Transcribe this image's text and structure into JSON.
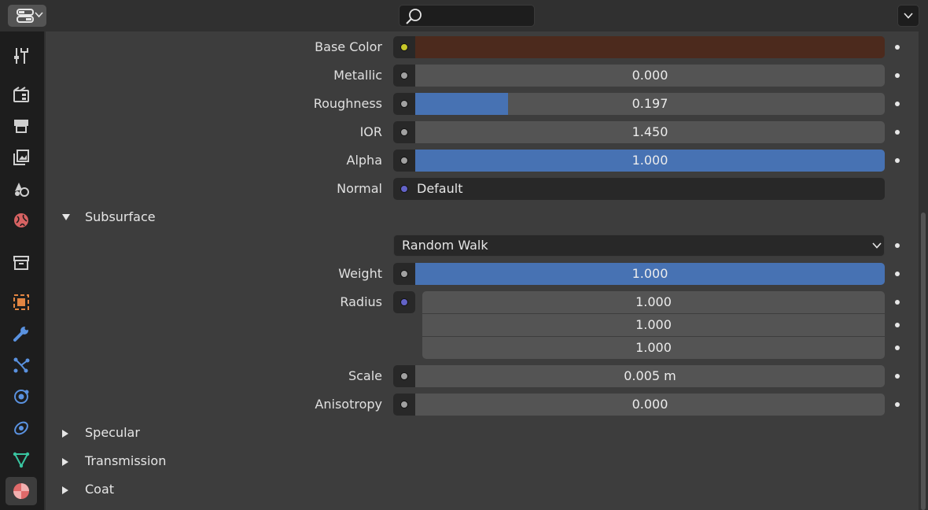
{
  "header": {
    "editor_icon": "editor-type-icon",
    "search_placeholder": "",
    "options_icon": "chevron-down-icon"
  },
  "tabs": [
    {
      "name": "tool-icon",
      "color": "#cfcfcf"
    },
    {
      "name": "render-icon",
      "color": "#cfcfcf"
    },
    {
      "name": "output-icon",
      "color": "#cfcfcf"
    },
    {
      "name": "view-layer-icon",
      "color": "#cfcfcf"
    },
    {
      "name": "scene-icon",
      "color": "#cfcfcf"
    },
    {
      "name": "world-icon",
      "color": "#d76262"
    },
    {
      "name": "collection-icon",
      "color": "#cfcfcf"
    },
    {
      "name": "object-icon",
      "color": "#e28542"
    },
    {
      "name": "modifier-icon",
      "color": "#5a92e0"
    },
    {
      "name": "particles-icon",
      "color": "#5a92e0"
    },
    {
      "name": "physics-icon",
      "color": "#5a92e0"
    },
    {
      "name": "constraints-icon",
      "color": "#5a92e0"
    },
    {
      "name": "data-icon",
      "color": "#39c4a0"
    },
    {
      "name": "material-icon",
      "color": "#e06a6a",
      "active": true
    }
  ],
  "properties": {
    "base_color": {
      "label": "Base Color",
      "color": "#4c2a1d",
      "socket_color": "#c7c729"
    },
    "metallic": {
      "label": "Metallic",
      "value": "0.000",
      "fraction": 0
    },
    "roughness": {
      "label": "Roughness",
      "value": "0.197",
      "fraction": 0.197
    },
    "ior": {
      "label": "IOR",
      "value": "1.450",
      "fraction": 0
    },
    "alpha": {
      "label": "Alpha",
      "value": "1.000",
      "fraction": 1
    },
    "normal": {
      "label": "Normal",
      "value": "Default",
      "socket_color": "#6363c7"
    }
  },
  "subsurface": {
    "title": "Subsurface",
    "method": "Random Walk",
    "weight": {
      "label": "Weight",
      "value": "1.000",
      "fraction": 1
    },
    "radius": {
      "label": "Radius",
      "values": [
        "1.000",
        "1.000",
        "1.000"
      ],
      "socket_color": "#6363c7"
    },
    "scale": {
      "label": "Scale",
      "value": "0.005 m",
      "fraction": 0
    },
    "anisotropy": {
      "label": "Anisotropy",
      "value": "0.000",
      "fraction": 0
    }
  },
  "sections": {
    "specular": "Specular",
    "transmission": "Transmission",
    "coat": "Coat"
  },
  "colors": {
    "accent": "#4772b3",
    "grey_socket": "#a1a1a1"
  }
}
